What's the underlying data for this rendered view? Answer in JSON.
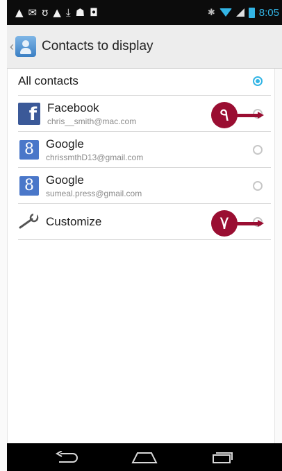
{
  "status_bar": {
    "notification_icons": [
      "▲",
      "✉",
      "ʊ",
      "▲",
      "⤓",
      "☗",
      "◘"
    ],
    "time": "8:05"
  },
  "action_bar": {
    "title": "Contacts to display"
  },
  "list": {
    "all_contacts_label": "All contacts",
    "accounts": [
      {
        "name": "Facebook",
        "account": "chris__smith@mac.com",
        "icon": "facebook-icon"
      },
      {
        "name": "Google",
        "account": "chrissmthD13@gmail.com",
        "icon": "google-icon"
      },
      {
        "name": "Google",
        "account": "sumeal.press@gmail.com",
        "icon": "google-icon"
      }
    ],
    "customize_label": "Customize"
  },
  "callouts": [
    "٩",
    "٧"
  ],
  "colors": {
    "accent": "#33b5e5",
    "callout": "#9a0e32",
    "facebook": "#3b5998",
    "google": "#4a77c9"
  }
}
